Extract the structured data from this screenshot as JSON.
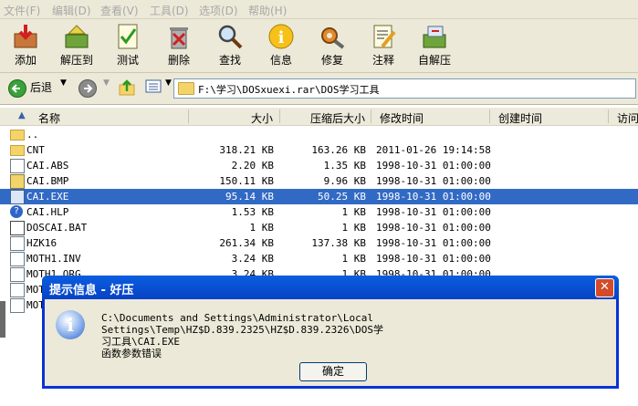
{
  "menu": [
    "文件(F)",
    "编辑(D)",
    "查看(V)",
    "工具(D)",
    "选项(D)",
    "帮助(H)"
  ],
  "toolbar": [
    {
      "label": "添加",
      "icon": "add-icon"
    },
    {
      "label": "解压到",
      "icon": "extract-icon"
    },
    {
      "label": "测试",
      "icon": "test-icon"
    },
    {
      "label": "删除",
      "icon": "delete-icon"
    },
    {
      "label": "查找",
      "icon": "find-icon"
    },
    {
      "label": "信息",
      "icon": "info-icon"
    },
    {
      "label": "修复",
      "icon": "repair-icon"
    },
    {
      "label": "注释",
      "icon": "comment-icon"
    },
    {
      "label": "自解压",
      "icon": "sfx-icon"
    }
  ],
  "nav": {
    "back_label": "后退",
    "path": "F:\\学习\\DOSxuexi.rar\\DOS学习工具"
  },
  "columns": {
    "name": "名称",
    "size": "大小",
    "packed": "压缩后大小",
    "modified": "修改时间",
    "created": "创建时间",
    "accessed": "访问"
  },
  "files": [
    {
      "name": "..",
      "size": "",
      "packed": "",
      "modified": "",
      "type": "folder"
    },
    {
      "name": "CNT",
      "size": "318.21 KB",
      "packed": "163.26 KB",
      "modified": "2011-01-26 19:14:58",
      "type": "folder"
    },
    {
      "name": "CAI.ABS",
      "size": "2.20 KB",
      "packed": "1.35 KB",
      "modified": "1998-10-31 01:00:00",
      "type": "file"
    },
    {
      "name": "CAI.BMP",
      "size": "150.11 KB",
      "packed": "9.96 KB",
      "modified": "1998-10-31 01:00:00",
      "type": "bmp"
    },
    {
      "name": "CAI.EXE",
      "size": "95.14 KB",
      "packed": "50.25 KB",
      "modified": "1998-10-31 01:00:00",
      "type": "exe"
    },
    {
      "name": "CAI.HLP",
      "size": "1.53 KB",
      "packed": "1 KB",
      "modified": "1998-10-31 01:00:00",
      "type": "hlp"
    },
    {
      "name": "DOSCAI.BAT",
      "size": "1 KB",
      "packed": "1 KB",
      "modified": "1998-10-31 01:00:00",
      "type": "bat"
    },
    {
      "name": "HZK16",
      "size": "261.34 KB",
      "packed": "137.38 KB",
      "modified": "1998-10-31 01:00:00",
      "type": "file"
    },
    {
      "name": "MOTH1.INV",
      "size": "3.24 KB",
      "packed": "1 KB",
      "modified": "1998-10-31 01:00:00",
      "type": "file"
    },
    {
      "name": "MOTH1.ORG",
      "size": "3.24 KB",
      "packed": "1 KB",
      "modified": "1998-10-31 01:00:00",
      "type": "file"
    },
    {
      "name": "MOT",
      "size": "",
      "packed": "",
      "modified": "",
      "type": "file"
    },
    {
      "name": "MOT",
      "size": "",
      "packed": "",
      "modified": "",
      "type": "file"
    }
  ],
  "selected_index": 4,
  "dialog": {
    "title": "提示信息 - 好压",
    "message_line1": "C:\\Documents and Settings\\Administrator\\Local Settings\\Temp\\HZ$D.839.2325\\HZ$D.839.2326\\DOS学",
    "message_line2": "习工具\\CAI.EXE",
    "message_line3": "函数参数错误",
    "ok_label": "确定"
  }
}
